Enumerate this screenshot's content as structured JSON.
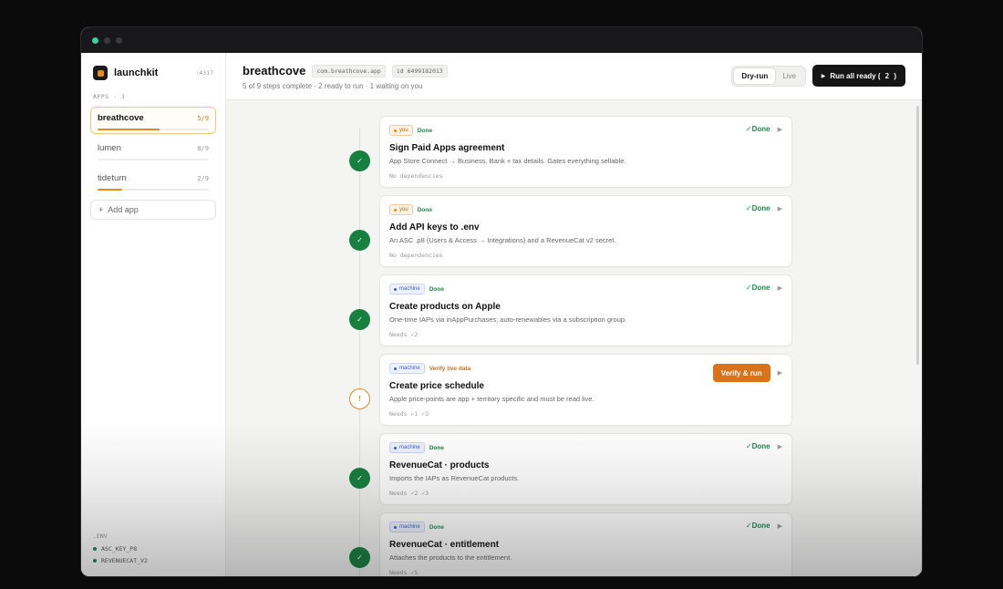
{
  "colors": {
    "accent": "#e8891c",
    "done": "#16803f",
    "machine": "#3b5ccc",
    "dark": "#151515"
  },
  "sidebar": {
    "brand": "launchkit",
    "port": ":4317",
    "apps_label": "APPS · 3",
    "apps": [
      {
        "name": "breathcove",
        "count": "5/9",
        "progress": 0.556
      },
      {
        "name": "lumen",
        "count": "0/9",
        "progress": 0
      },
      {
        "name": "tideturn",
        "count": "2/9",
        "progress": 0.222
      }
    ],
    "add_app": "Add app",
    "add_icon": "+",
    "env_label": ".ENV",
    "env": [
      "ASC_KEY_P8",
      "REVENUECAT_V2"
    ]
  },
  "header": {
    "title": "breathcove",
    "bundle": "com.breathcove.app",
    "app_id": "id 6499182013",
    "subtitle": "5 of 9 steps complete · 2 ready to run · 1 waiting on you",
    "mode_dry": "Dry-run",
    "mode_live": "Live",
    "run_all": "Run all ready (",
    "run_count": "2",
    "run_close": ")"
  },
  "steps": [
    {
      "actor": "you",
      "status": "Done",
      "title": "Sign Paid Apps agreement",
      "desc": "App Store Connect → Business. Bank + tax details. Gates everything sellable.",
      "deps": "No dependencies",
      "right": "✓Done",
      "node": "✓"
    },
    {
      "actor": "you",
      "status": "Done",
      "title": "Add API keys to .env",
      "desc": "An ASC .p8 (Users & Access → Integrations) and a RevenueCat v2 secret.",
      "deps": "No dependencies",
      "right": "✓Done",
      "node": "✓"
    },
    {
      "actor": "machine",
      "status": "Done",
      "title": "Create products on Apple",
      "desc": "One-time IAPs via inAppPurchases; auto-renewables via a subscription group.",
      "deps": "Needs ✓2",
      "right": "✓Done",
      "node": "✓"
    },
    {
      "actor": "machine",
      "status": "Verify live data",
      "title": "Create price schedule",
      "desc": "Apple price-points are app + territory specific and must be read live.",
      "deps": "Needs ✓1 ✓3",
      "right": "Verify & run",
      "node": "!"
    },
    {
      "actor": "machine",
      "status": "Done",
      "title": "RevenueCat · products",
      "desc": "Imports the IAPs as RevenueCat products.",
      "deps": "Needs ✓2 ✓3",
      "right": "✓Done",
      "node": "✓"
    },
    {
      "actor": "machine",
      "status": "Done",
      "title": "RevenueCat · entitlement",
      "desc": "Attaches the products to the entitlement.",
      "deps": "Needs ✓5",
      "right": "✓Done",
      "node": "✓"
    }
  ],
  "icons": {
    "play": "▶",
    "chevron": "▶"
  }
}
